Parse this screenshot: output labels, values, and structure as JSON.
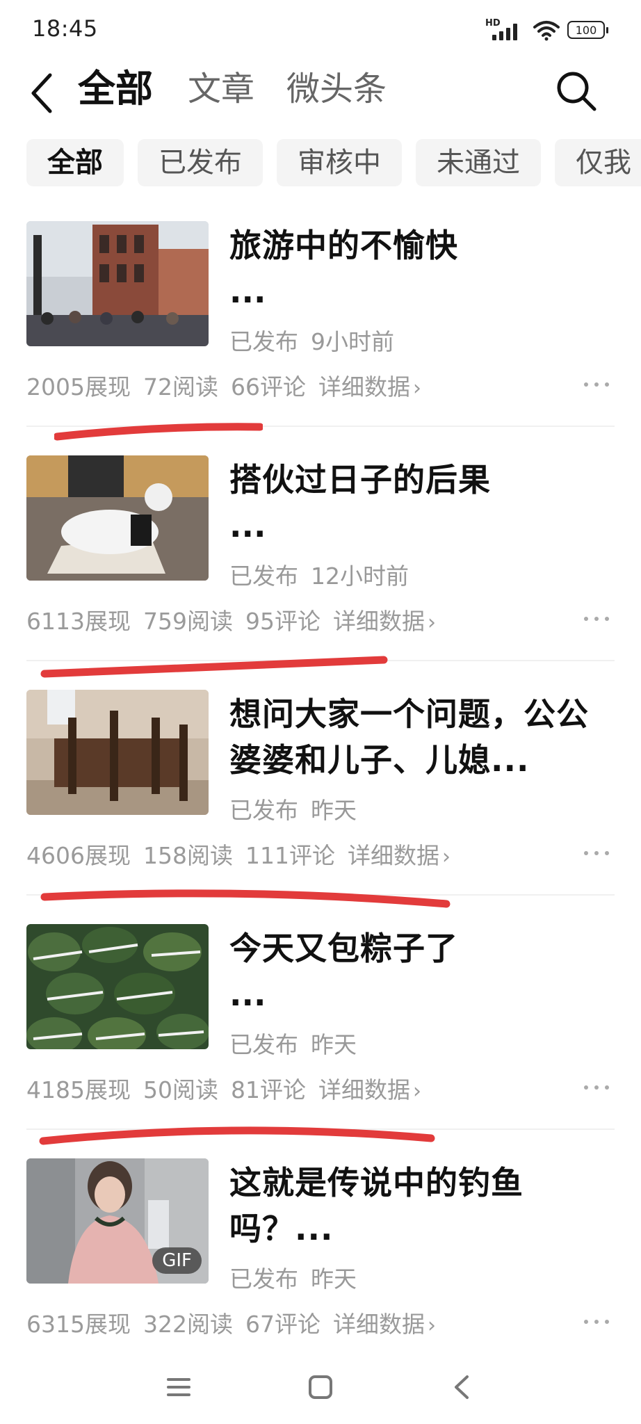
{
  "status_bar": {
    "time": "18:45",
    "network": "HD",
    "battery": "100",
    "icons": [
      "signal-icon",
      "wifi-icon",
      "battery-icon"
    ]
  },
  "header": {
    "tabs": [
      {
        "label": "全部",
        "active": true
      },
      {
        "label": "文章",
        "active": false
      },
      {
        "label": "微头条",
        "active": false
      }
    ],
    "icons": [
      "back-icon",
      "search-icon"
    ]
  },
  "filters": [
    {
      "label": "全部",
      "active": true
    },
    {
      "label": "已发布",
      "active": false
    },
    {
      "label": "审核中",
      "active": false
    },
    {
      "label": "未通过",
      "active": false
    },
    {
      "label": "仅我",
      "active": false
    }
  ],
  "items": [
    {
      "title": "旅游中的不愉快",
      "ellipsis": "...",
      "status": "已发布",
      "time": "9小时前",
      "impressions": "2005展现",
      "reads": "72阅读",
      "comments": "66评论",
      "detail": "详细数据",
      "thumb": "historic-building-crowd",
      "gif": false
    },
    {
      "title": "搭伙过日子的后果",
      "ellipsis": "...",
      "status": "已发布",
      "time": "12小时前",
      "impressions": "6113展现",
      "reads": "759阅读",
      "comments": "95评论",
      "detail": "详细数据",
      "thumb": "person-kneeling-white-robe",
      "gif": false
    },
    {
      "title": "想问大家一个问题，公公婆婆和儿子、儿媳...",
      "ellipsis": "",
      "status": "已发布",
      "time": "昨天",
      "impressions": "4606展现",
      "reads": "158阅读",
      "comments": "111评论",
      "detail": "详细数据",
      "thumb": "dining-table-chairs",
      "gif": false
    },
    {
      "title": "今天又包粽子了",
      "ellipsis": "...",
      "status": "已发布",
      "time": "昨天",
      "impressions": "4185展现",
      "reads": "50阅读",
      "comments": "81评论",
      "detail": "详细数据",
      "thumb": "zongzi-pile",
      "gif": false
    },
    {
      "title": "这就是传说中的钓鱼吗？...",
      "ellipsis": "",
      "status": "已发布",
      "time": "昨天",
      "impressions": "6315展现",
      "reads": "322阅读",
      "comments": "67评论",
      "detail": "详细数据",
      "thumb": "woman-pink-dress",
      "gif": true,
      "gif_label": "GIF"
    }
  ],
  "nav": [
    "menu-icon",
    "home-icon",
    "back-icon"
  ],
  "colors": {
    "chip_bg": "#f4f4f4",
    "meta_text": "#999999",
    "annotation_red": "#e23b3b"
  }
}
